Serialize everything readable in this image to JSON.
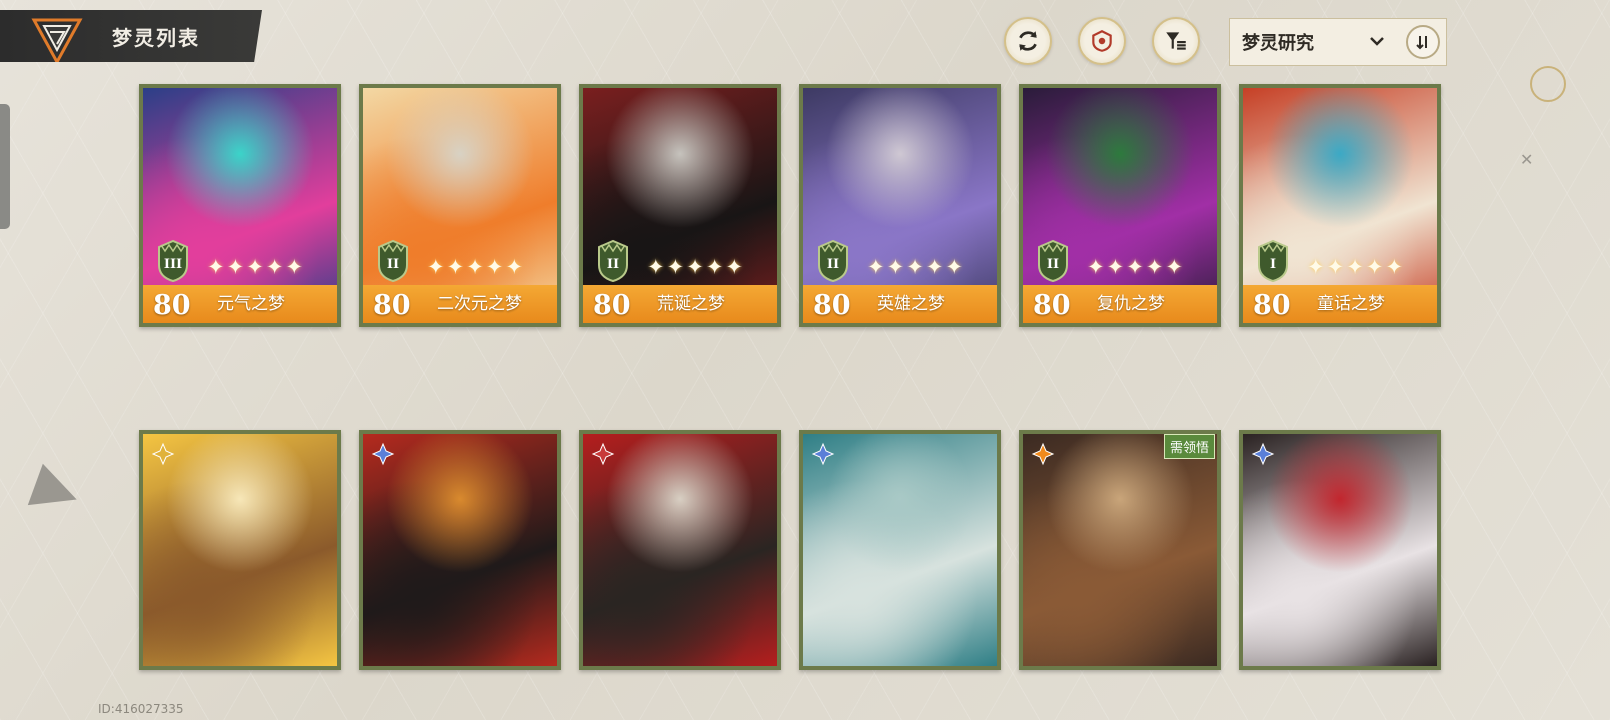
{
  "header": {
    "title": "梦灵列表"
  },
  "toolbar": {
    "refresh_icon": "refresh-icon",
    "shield_icon": "shield-target-icon",
    "filter_icon": "filter-list-icon",
    "sort": {
      "label": "梦灵研究",
      "order_icon": "sort-order-icon"
    }
  },
  "cards_top": [
    {
      "level": "80",
      "name": "元气之梦",
      "rank": "III",
      "stars": 5,
      "palette": [
        "#2b3f87",
        "#e23e9c",
        "#3bd4c9"
      ]
    },
    {
      "level": "80",
      "name": "二次元之梦",
      "rank": "II",
      "stars": 5,
      "palette": [
        "#f3d8a4",
        "#ef7d2b",
        "#d8d2c4"
      ]
    },
    {
      "level": "80",
      "name": "荒诞之梦",
      "rank": "II",
      "stars": 5,
      "palette": [
        "#7a1f1f",
        "#181515",
        "#c6c3bd"
      ]
    },
    {
      "level": "80",
      "name": "英雄之梦",
      "rank": "II",
      "stars": 5,
      "palette": [
        "#3d3a63",
        "#8a76c7",
        "#cfc8d3"
      ]
    },
    {
      "level": "80",
      "name": "复仇之梦",
      "rank": "II",
      "stars": 5,
      "palette": [
        "#2a1c3a",
        "#a12fa6",
        "#2d7a3d"
      ]
    },
    {
      "level": "80",
      "name": "童话之梦",
      "rank": "I",
      "stars": 5,
      "palette": [
        "#c64026",
        "#f0e4d2",
        "#3ba9c5"
      ]
    }
  ],
  "cards_bottom": [
    {
      "element": "sun-element-icon",
      "tag": "",
      "palette": [
        "#f4c542",
        "#8b5a2b",
        "#f7e7b8"
      ]
    },
    {
      "element": "crystal-element-icon",
      "tag": "",
      "palette": [
        "#b52a1e",
        "#1f1a1a",
        "#d98a2e"
      ]
    },
    {
      "element": "flame-element-icon",
      "tag": "",
      "palette": [
        "#b51e1e",
        "#2a2522",
        "#d8cfc3"
      ]
    },
    {
      "element": "crystal-element-icon",
      "tag": "",
      "palette": [
        "#2f7f86",
        "#d7e2de",
        "#a9c9c6"
      ]
    },
    {
      "element": "sun-orange-element-icon",
      "tag": "需领悟",
      "palette": [
        "#3b2a22",
        "#8a5a36",
        "#c9a57a"
      ]
    },
    {
      "element": "crystal-element-icon",
      "tag": "",
      "palette": [
        "#2a2222",
        "#e8e2e4",
        "#c2262e"
      ]
    }
  ],
  "footer": {
    "id_text": "ID:416027335"
  },
  "colors": {
    "card_border": "#6c7a4a",
    "card_bottom": "#e88a1c",
    "title_bg": "#2c2c2c",
    "accent_gold": "#d4c08a"
  }
}
